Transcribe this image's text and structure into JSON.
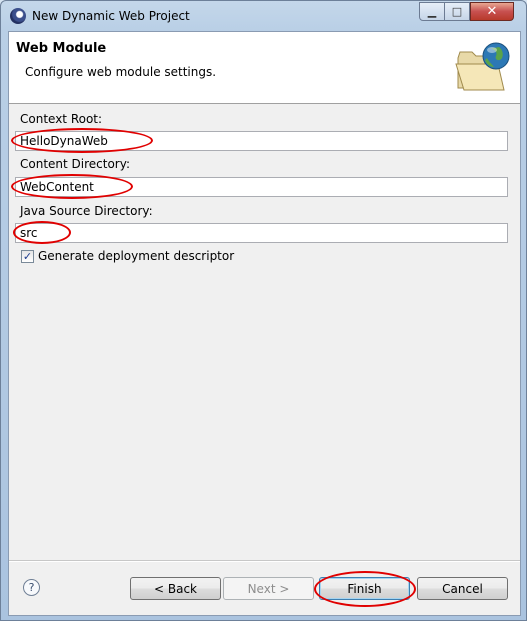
{
  "window": {
    "title": "New Dynamic Web Project",
    "minimize_glyph": "▁",
    "maximize_glyph": "□",
    "close_glyph": "✕"
  },
  "header": {
    "title": "Web Module",
    "description": "Configure web module settings.",
    "banner_icon": "folder-globe-icon"
  },
  "form": {
    "context_root": {
      "label": "Context Root:",
      "value": "HelloDynaWeb"
    },
    "content_directory": {
      "label": "Content Directory:",
      "value": "WebContent"
    },
    "java_source_directory": {
      "label": "Java Source Directory:",
      "value": "src"
    },
    "generate_descriptor": {
      "label": "Generate deployment descriptor",
      "checked": true,
      "check_glyph": "✓"
    }
  },
  "footer": {
    "help_glyph": "?",
    "back_label": "< Back",
    "next_label": "Next >",
    "finish_label": "Finish",
    "cancel_label": "Cancel"
  },
  "annotation_color": "#e00000"
}
